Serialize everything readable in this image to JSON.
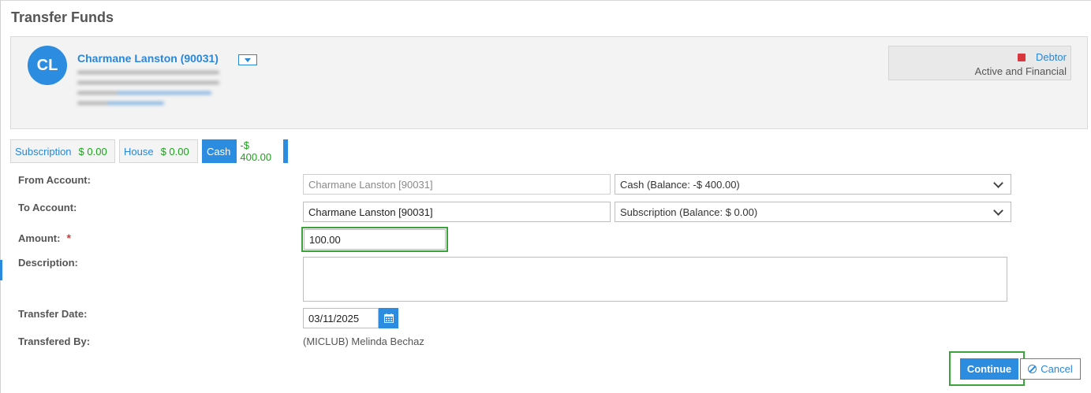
{
  "page": {
    "title": "Transfer Funds"
  },
  "member": {
    "initials": "CL",
    "name": "Charmane Lanston (90031)",
    "status_type": "Debtor",
    "status_text": "Active and Financial",
    "status_color": "#d9363e"
  },
  "accounts": [
    {
      "label": "Subscription",
      "amount": "$ 0.00"
    },
    {
      "label": "House",
      "amount": "$ 0.00"
    },
    {
      "label": "Cash",
      "amount": "-$ 400.00"
    }
  ],
  "form": {
    "from_account": {
      "label": "From Account:",
      "member_value": "Charmane Lanston [90031]",
      "account_value": "Cash (Balance: -$ 400.00)"
    },
    "to_account": {
      "label": "To Account:",
      "member_value": "Charmane Lanston [90031]",
      "account_value": "Subscription (Balance: $ 0.00)"
    },
    "amount": {
      "label": "Amount:",
      "required_mark": "*",
      "value": "100.00"
    },
    "description": {
      "label": "Description:",
      "value": ""
    },
    "transfer_date": {
      "label": "Transfer Date:",
      "value": "03/11/2025"
    },
    "transferred_by": {
      "label": "Transfered By:",
      "value": "(MICLUB) Melinda Bechaz"
    }
  },
  "actions": {
    "continue_label": "Continue",
    "cancel_label": "Cancel"
  },
  "colors": {
    "accent": "#2b8ce0",
    "highlight": "#3aa43a",
    "amount_green": "#1aa31a"
  }
}
